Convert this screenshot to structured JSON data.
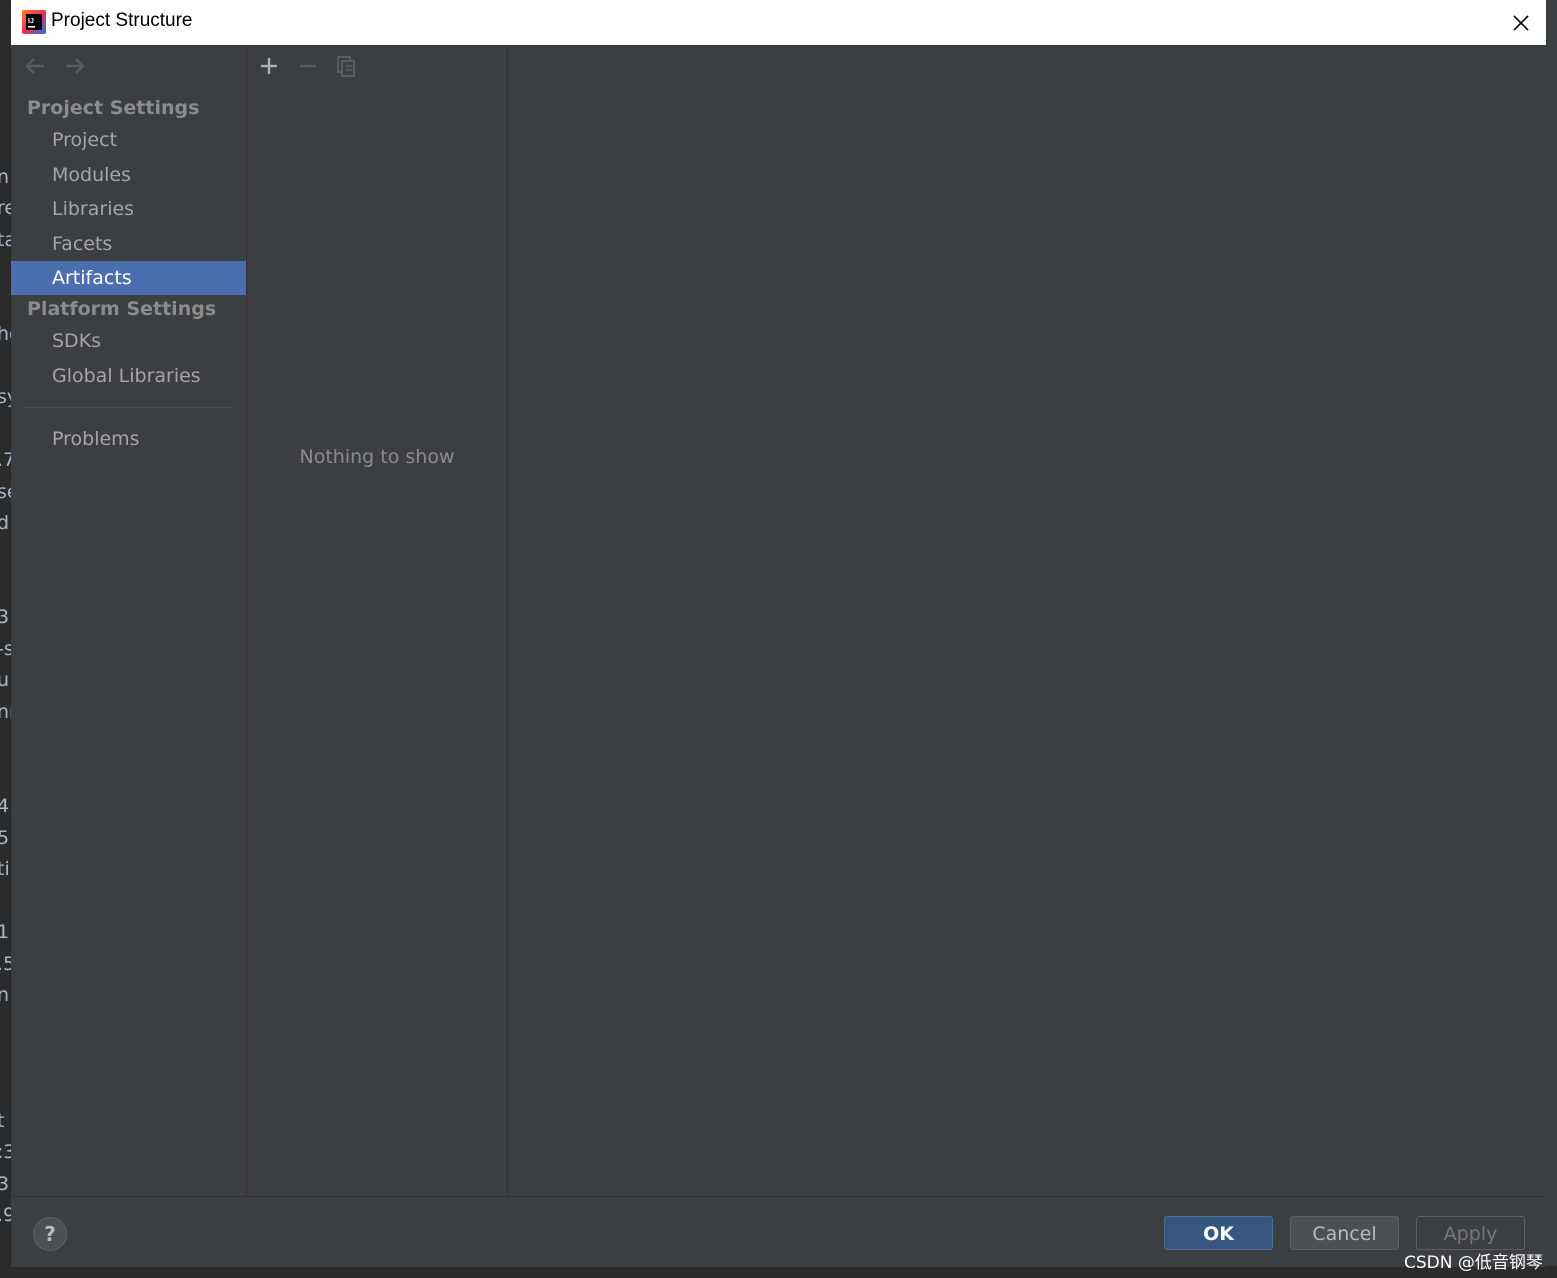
{
  "window": {
    "title": "Project Structure",
    "close_icon": "close-icon"
  },
  "sidebar": {
    "back_icon": "arrow-left-icon",
    "forward_icon": "arrow-right-icon",
    "project_settings_header": "Project Settings",
    "platform_settings_header": "Platform Settings",
    "items": [
      {
        "label": "Project"
      },
      {
        "label": "Modules"
      },
      {
        "label": "Libraries"
      },
      {
        "label": "Facets"
      },
      {
        "label": "Artifacts",
        "selected": true
      },
      {
        "label": "SDKs"
      },
      {
        "label": "Global Libraries"
      },
      {
        "label": "Problems"
      }
    ]
  },
  "middle": {
    "toolbar_icons": [
      "plus-icon",
      "minus-icon",
      "copy-icon"
    ],
    "empty_text": "Nothing to show"
  },
  "footer": {
    "help_label": "?",
    "ok_label": "OK",
    "cancel_label": "Cancel",
    "apply_label": "Apply"
  },
  "watermark": "CSDN @低音钢琴",
  "background_fragments": [
    "n",
    "re",
    "ta",
    "he",
    "sy",
    ".7",
    "se",
    "d",
    "3",
    "-s",
    "u",
    "nr",
    "4.",
    "5",
    "ti",
    "1",
    ".5",
    "n:",
    "t",
    ":3",
    "3",
    ".9"
  ],
  "colors": {
    "dialog_bg": "#3c3f41",
    "selection": "#4b6eaf",
    "ok_button": "#365880",
    "text_muted": "#8c8c8c"
  }
}
